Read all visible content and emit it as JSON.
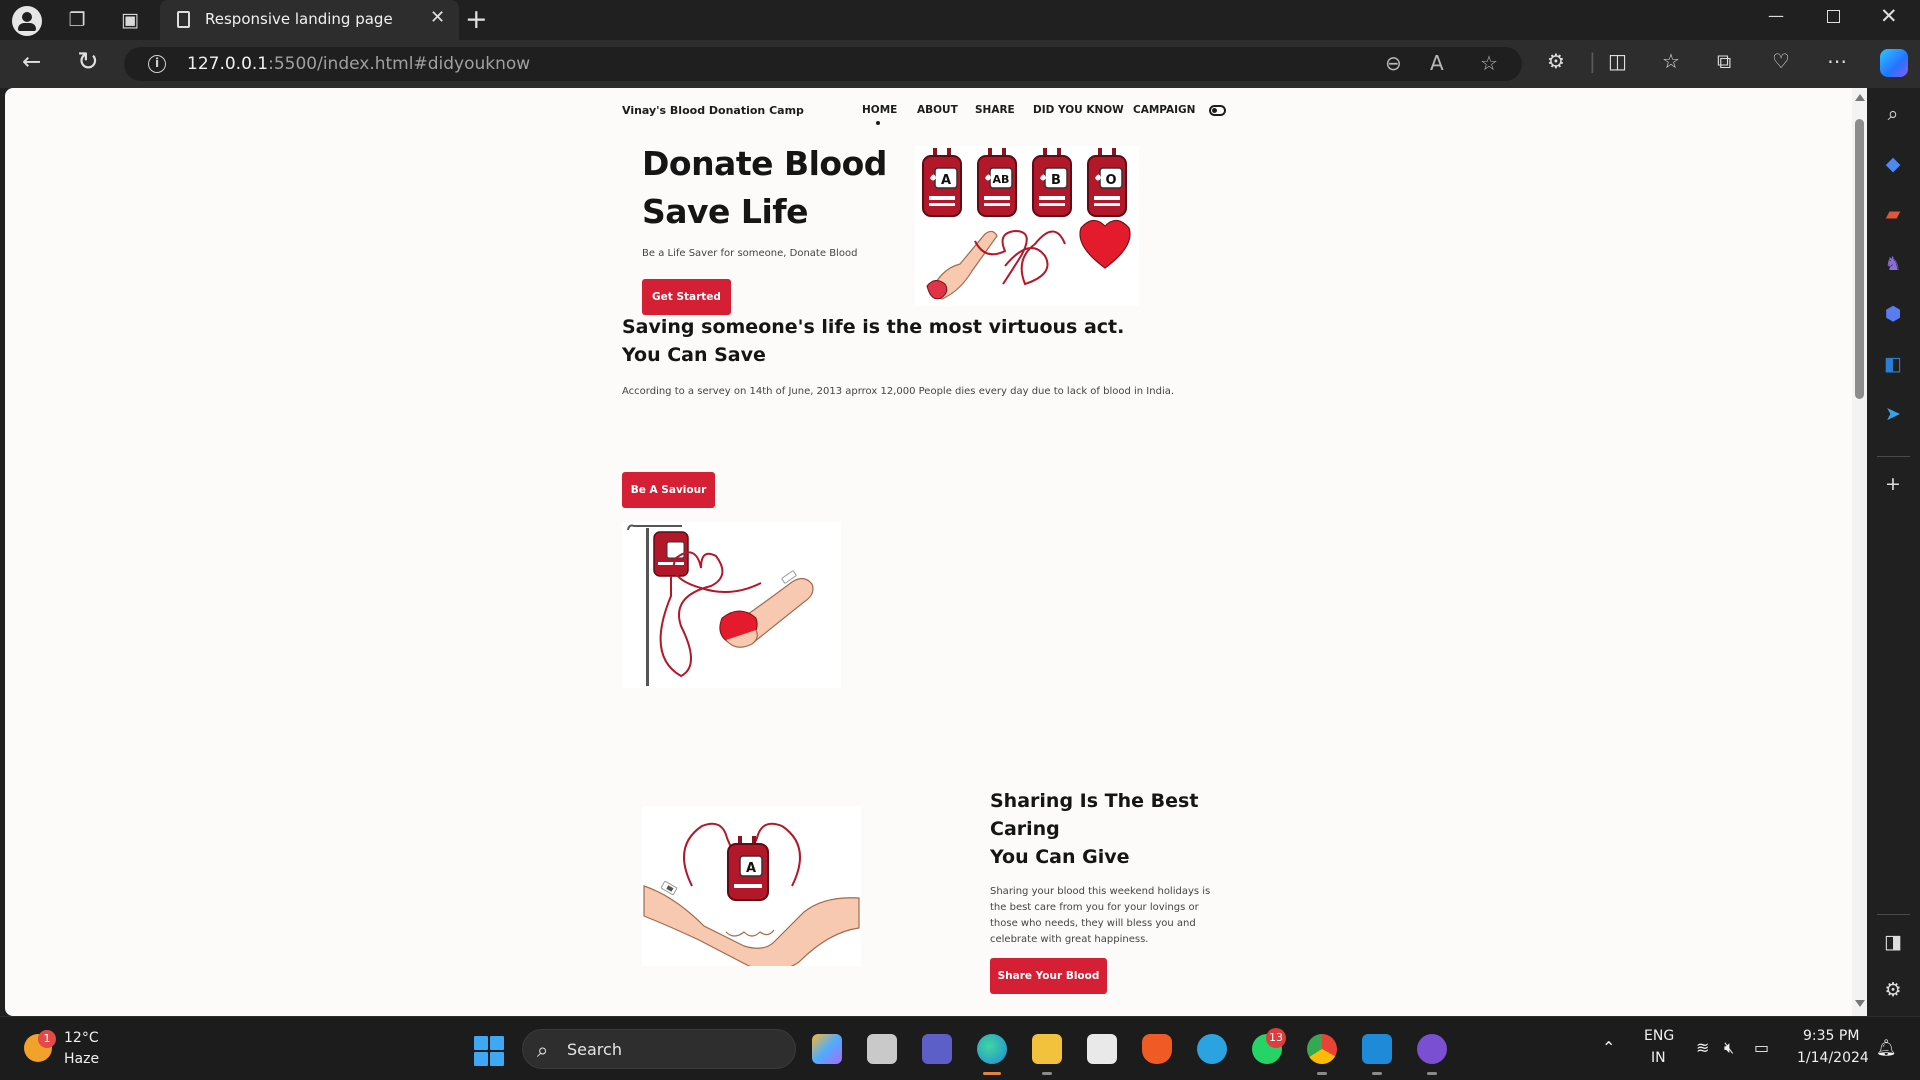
{
  "browser": {
    "tab_title": "Responsive landing page",
    "url_host": "127.0.0.1",
    "url_path": ":5500/index.html#didyouknow"
  },
  "nav": {
    "brand": "Vinay's Blood Donation Camp",
    "links": [
      "HOME",
      "ABOUT",
      "SHARE",
      "DID YOU KNOW",
      "CAMPAIGN"
    ],
    "active": "HOME"
  },
  "hero": {
    "title_line1": "Donate Blood",
    "title_line2": "Save Life",
    "subtitle": "Be a Life Saver for someone, Donate Blood",
    "button": "Get Started",
    "blood_types": [
      "A",
      "AB",
      "B",
      "O"
    ]
  },
  "about": {
    "heading_line1": "Saving someone's life is the most virtuous act.",
    "heading_line2": "You Can Save",
    "text": "According to a servey on 14th of June, 2013 aprrox 12,000 People dies every day due to lack of blood in India.",
    "button": "Be A Saviour"
  },
  "share": {
    "heading_line1": "Sharing Is The Best",
    "heading_line2": "Caring",
    "heading_line3": "You Can Give",
    "text": "Sharing your blood this weekend holidays is the best care from you for your lovings or those who needs, they will bless you and celebrate with great happiness.",
    "button": "Share Your Blood",
    "bag_label": "A"
  },
  "taskbar": {
    "weather_temp": "12°C",
    "weather_desc": "Haze",
    "weather_badge": "1",
    "search_placeholder": "Search",
    "whatsapp_badge": "13",
    "language_line1": "ENG",
    "language_line2": "IN",
    "time": "9:35 PM",
    "date": "1/14/2024"
  },
  "colors": {
    "accent": "#d51f35",
    "page_bg": "#fcfbfa",
    "chrome_bg": "#202020"
  }
}
